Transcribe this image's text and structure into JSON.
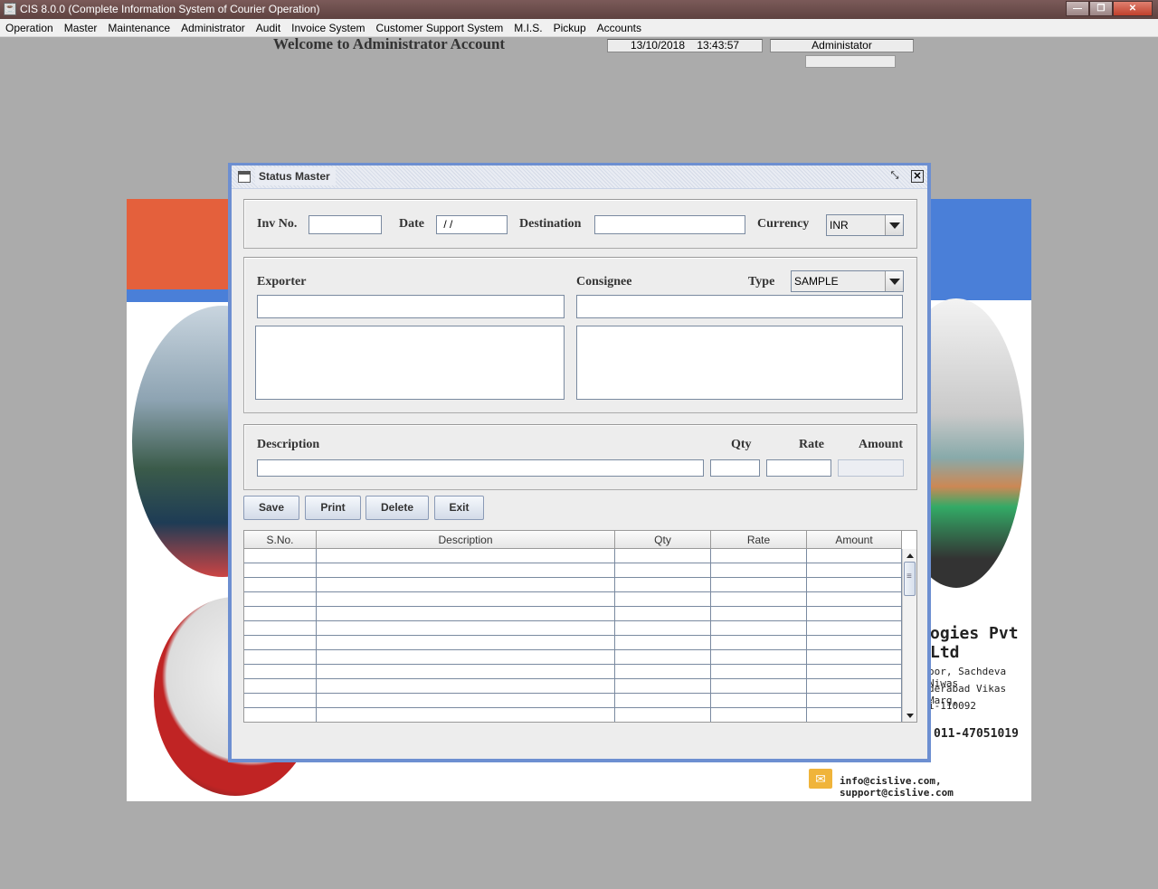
{
  "window": {
    "title": "CIS 8.0.0 (Complete Information System of Courier Operation)"
  },
  "menu": [
    {
      "label": "Operation",
      "name": "menu-operation"
    },
    {
      "label": "Master",
      "name": "menu-master"
    },
    {
      "label": "Maintenance",
      "name": "menu-maintenance"
    },
    {
      "label": "Administrator",
      "name": "menu-administrator"
    },
    {
      "label": "Audit",
      "name": "menu-audit"
    },
    {
      "label": "Invoice System",
      "name": "menu-invoice-system"
    },
    {
      "label": "Customer Support System",
      "name": "menu-customer-support-system"
    },
    {
      "label": "M.I.S.",
      "name": "menu-mis"
    },
    {
      "label": "Pickup",
      "name": "menu-pickup"
    },
    {
      "label": "Accounts",
      "name": "menu-accounts"
    }
  ],
  "header": {
    "welcome": "Welcome to Administrator Account",
    "datetime": "13/10/2018    13:43:57",
    "user": "Administator"
  },
  "poster": {
    "company": "ogies Pvt Ltd",
    "address_lines": [
      "oor, Sachdeva Niwas",
      "derabad Vikas Marg,",
      "i-110092"
    ],
    "phone": "011-47051019",
    "email": "info@cislive.com, support@cislive.com"
  },
  "form": {
    "title": "Status Master",
    "invoice": {
      "inv_no_label": "Inv No.",
      "inv_no_value": "",
      "date_label": "Date",
      "date_value": " / /",
      "destination_label": "Destination",
      "destination_value": "",
      "currency_label": "Currency",
      "currency_value": "INR"
    },
    "party": {
      "exporter_label": "Exporter",
      "consignee_label": "Consignee",
      "type_label": "Type",
      "type_value": "SAMPLE"
    },
    "item": {
      "description_label": "Description",
      "qty_label": "Qty",
      "rate_label": "Rate",
      "amount_label": "Amount"
    },
    "buttons": {
      "save": "Save",
      "print": "Print",
      "delete": "Delete",
      "exit": "Exit"
    },
    "table": {
      "columns": [
        "S.No.",
        "Description",
        "Qty",
        "Rate",
        "Amount"
      ],
      "rows": [
        [],
        [],
        [],
        [],
        [],
        [],
        [],
        [],
        [],
        [],
        [],
        []
      ]
    }
  },
  "colors": {
    "frame_border": "#6d8fd1",
    "desktop": "#ababab",
    "titlebar": "#6b4e4d"
  }
}
